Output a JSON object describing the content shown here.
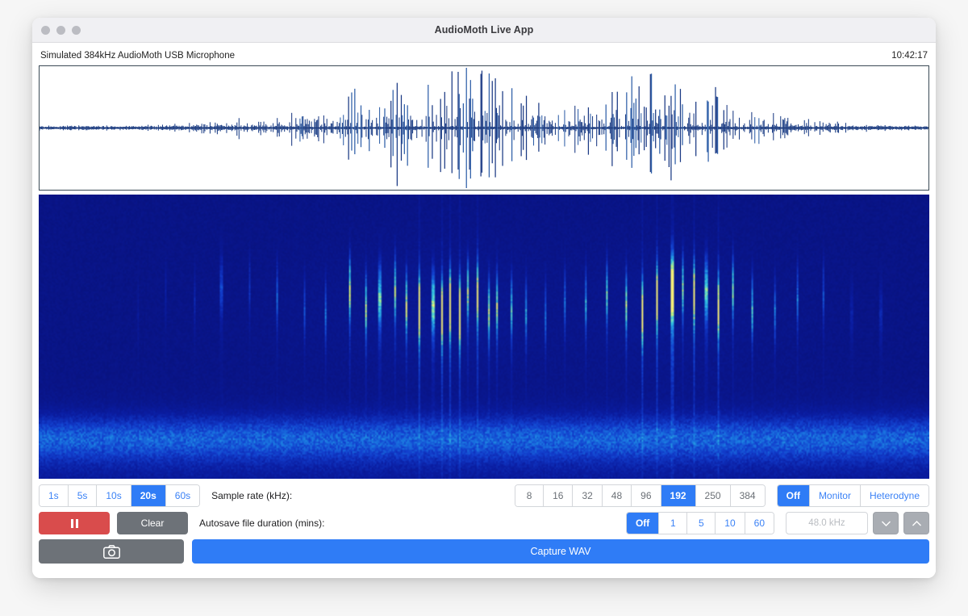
{
  "window": {
    "title": "AudioMoth Live App",
    "traffic_lights": [
      "close-button",
      "minimize-button",
      "zoom-button"
    ]
  },
  "status": {
    "device": "Simulated 384kHz AudioMoth USB Microphone",
    "time": "10:42:17"
  },
  "displays": {
    "waveform": {
      "name": "waveform-display"
    },
    "spectrogram": {
      "name": "spectrogram-display",
      "background_color": "#081078"
    }
  },
  "controls": {
    "time_scale": {
      "options": [
        "1s",
        "5s",
        "10s",
        "20s",
        "60s"
      ],
      "selected": "20s"
    },
    "sample_rate": {
      "label": "Sample rate (kHz):",
      "options": [
        "8",
        "16",
        "32",
        "48",
        "96",
        "192",
        "250",
        "384"
      ],
      "selected": "192"
    },
    "monitor": {
      "options": [
        "Off",
        "Monitor",
        "Heterodyne"
      ],
      "selected": "Off"
    },
    "autosave": {
      "label": "Autosave file duration (mins):",
      "options": [
        "Off",
        "1",
        "5",
        "10",
        "60"
      ],
      "selected": "Off"
    },
    "heterodyne_frequency": {
      "value": "48.0 kHz",
      "decrease_icon": "chevron-down-icon",
      "increase_icon": "chevron-up-icon"
    },
    "transport": {
      "pause_label": "",
      "pause_icon": "pause-icon",
      "clear_label": "Clear"
    },
    "capture": {
      "screenshot_icon": "camera-icon",
      "capture_wav_label": "Capture WAV"
    }
  },
  "colors": {
    "accent_blue": "#2f7cf6",
    "link_blue": "#3b82f6",
    "danger_red": "#d94c4c",
    "gray_button": "#6d7278",
    "spectrogram_bg": "#081078"
  }
}
